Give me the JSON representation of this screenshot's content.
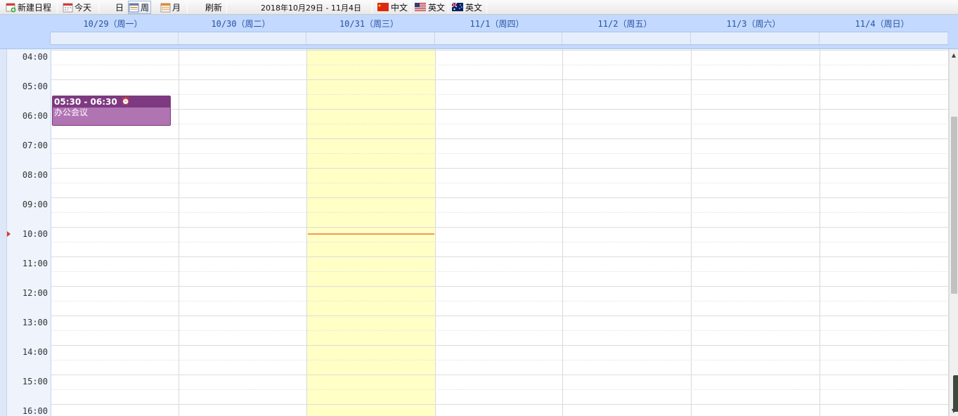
{
  "toolbar": {
    "new_event": "新建日程",
    "today": "今天",
    "view_day": "日",
    "view_week": "周",
    "view_month": "月",
    "refresh": "刷新",
    "date_range": "2018年10月29日 - 11月4日",
    "lang_zh": "中文",
    "lang_en_us": "英文",
    "lang_en_au": "英文",
    "active_view": "week"
  },
  "week": {
    "days": [
      {
        "label": "10/29（周一）"
      },
      {
        "label": "10/30（周二）"
      },
      {
        "label": "10/31（周三）",
        "today": true
      },
      {
        "label": "11/1（周四）"
      },
      {
        "label": "11/2（周五）"
      },
      {
        "label": "11/3（周六）"
      },
      {
        "label": "11/4（周日）"
      }
    ]
  },
  "times": [
    "04:00",
    "05:00",
    "06:00",
    "07:00",
    "08:00",
    "09:00",
    "10:00",
    "11:00",
    "12:00",
    "13:00",
    "14:00",
    "15:00",
    "16:00"
  ],
  "current_time_row": "10:00",
  "events": [
    {
      "time": "05:30 - 06:30",
      "title": "办公会议",
      "day": "10/29（周一）",
      "color": "#b174b3",
      "header_color": "#7d3a80"
    }
  ],
  "colors": {
    "header_bg": "#c3d9ff",
    "today_bg": "#ffffc6",
    "now_line": "#f4955e",
    "day_label": "#2952a3"
  },
  "icons": {
    "new_event": "calendar-add-icon",
    "today": "calendar-today-icon",
    "week": "calendar-week-icon",
    "month": "calendar-month-icon",
    "zh": "china-flag-icon",
    "en_us": "us-flag-icon",
    "en_au": "australia-flag-icon"
  }
}
